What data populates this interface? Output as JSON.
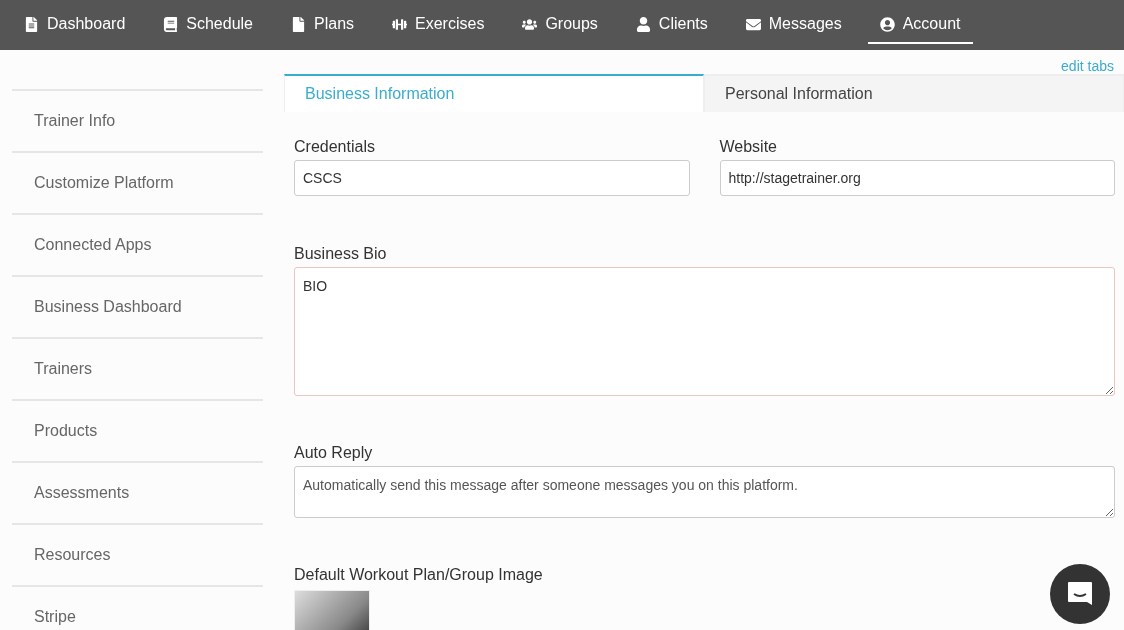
{
  "nav": [
    {
      "label": "Dashboard",
      "selected": false
    },
    {
      "label": "Schedule",
      "selected": false
    },
    {
      "label": "Plans",
      "selected": false
    },
    {
      "label": "Exercises",
      "selected": false
    },
    {
      "label": "Groups",
      "selected": false
    },
    {
      "label": "Clients",
      "selected": false
    },
    {
      "label": "Messages",
      "selected": false
    },
    {
      "label": "Account",
      "selected": true
    }
  ],
  "sidebar": {
    "items": [
      "Trainer Info",
      "Customize Platform",
      "Connected Apps",
      "Business Dashboard",
      "Trainers",
      "Products",
      "Assessments",
      "Resources",
      "Stripe"
    ]
  },
  "edit_tabs": "edit tabs",
  "tabs": [
    {
      "label": "Business Information",
      "selected": true
    },
    {
      "label": "Personal Information",
      "selected": false
    }
  ],
  "form": {
    "credentials": {
      "label": "Credentials",
      "value": "CSCS"
    },
    "website": {
      "label": "Website",
      "value": "http://stagetrainer.org"
    },
    "bio": {
      "label": "Business Bio",
      "value": "BIO"
    },
    "auto_reply": {
      "label": "Auto Reply",
      "placeholder": "Automatically send this message after someone messages you on this platform."
    },
    "image": {
      "label": "Default Workout Plan/Group Image"
    }
  }
}
